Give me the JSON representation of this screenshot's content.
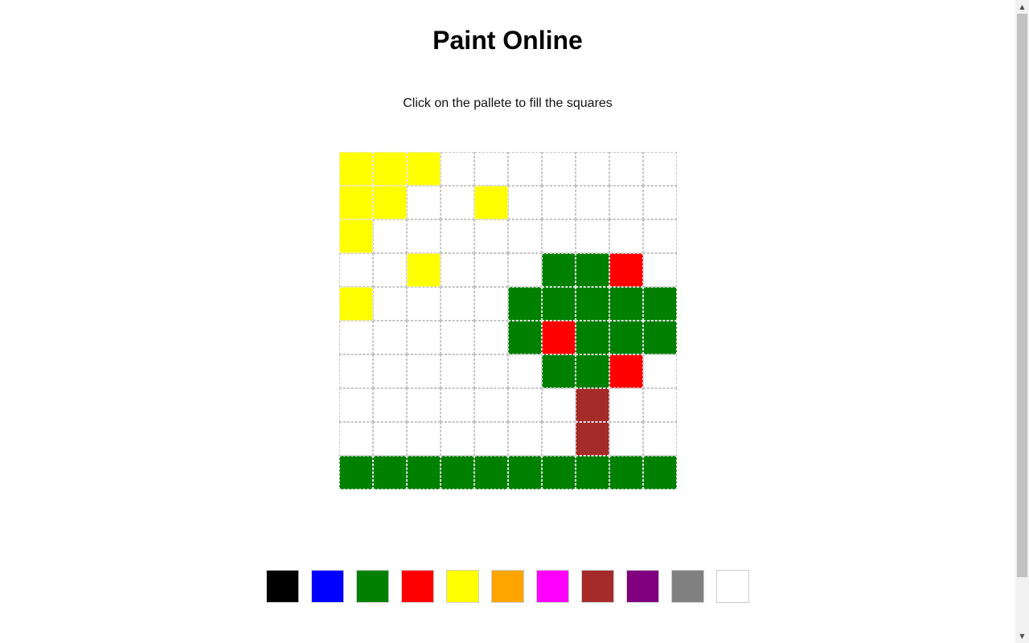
{
  "page": {
    "title": "Paint Online",
    "instruction": "Click on the pallete to fill the squares"
  },
  "grid": {
    "rows": 10,
    "cols": 10,
    "colors": {
      "W": "#ffffff",
      "Y": "#ffff00",
      "G": "#008000",
      "R": "#ff0000",
      "B": "#a52a2a"
    },
    "cells": [
      "YYYWWWWWWW",
      "YYWWYWWWWW",
      "YWWWWWWWWW",
      "WWYWWWGGRW",
      "YWWWWGGGGG",
      "WWWWWGRGGG",
      "WWWWWWGGRW",
      "WWWWWWWBWW",
      "WWWWWWWBWW",
      "GGGGGGGGGG"
    ]
  },
  "palette": [
    {
      "name": "black",
      "color": "#000000"
    },
    {
      "name": "blue",
      "color": "#0000ff"
    },
    {
      "name": "green",
      "color": "#008000"
    },
    {
      "name": "red",
      "color": "#ff0000"
    },
    {
      "name": "yellow",
      "color": "#ffff00"
    },
    {
      "name": "orange",
      "color": "#ffa500"
    },
    {
      "name": "magenta",
      "color": "#ff00ff"
    },
    {
      "name": "brown",
      "color": "#a52a2a"
    },
    {
      "name": "purple",
      "color": "#800080"
    },
    {
      "name": "gray",
      "color": "#808080"
    },
    {
      "name": "white",
      "color": "#ffffff"
    }
  ],
  "scrollbar": {
    "up_icon": "triangle-up-icon",
    "down_icon": "triangle-down-icon"
  }
}
